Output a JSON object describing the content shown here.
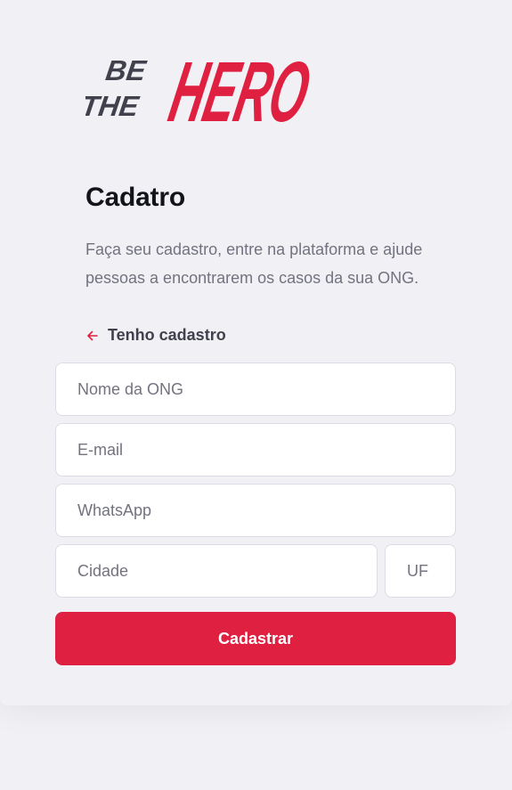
{
  "brand": {
    "line1": "BE",
    "line2": "THE",
    "word": "HERO",
    "accent_color": "#e02041",
    "dark_color": "#41414d"
  },
  "register": {
    "title": "Cadatro",
    "description": "Faça seu cadastro, entre na plataforma e ajude pessoas a encontrarem os casos da sua ONG.",
    "back_link_label": "Tenho cadastro",
    "back_icon": "arrow-left-icon"
  },
  "form": {
    "name_placeholder": "Nome da ONG",
    "email_placeholder": "E-mail",
    "whatsapp_placeholder": "WhatsApp",
    "city_placeholder": "Cidade",
    "uf_placeholder": "UF",
    "submit_label": "Cadastrar"
  }
}
